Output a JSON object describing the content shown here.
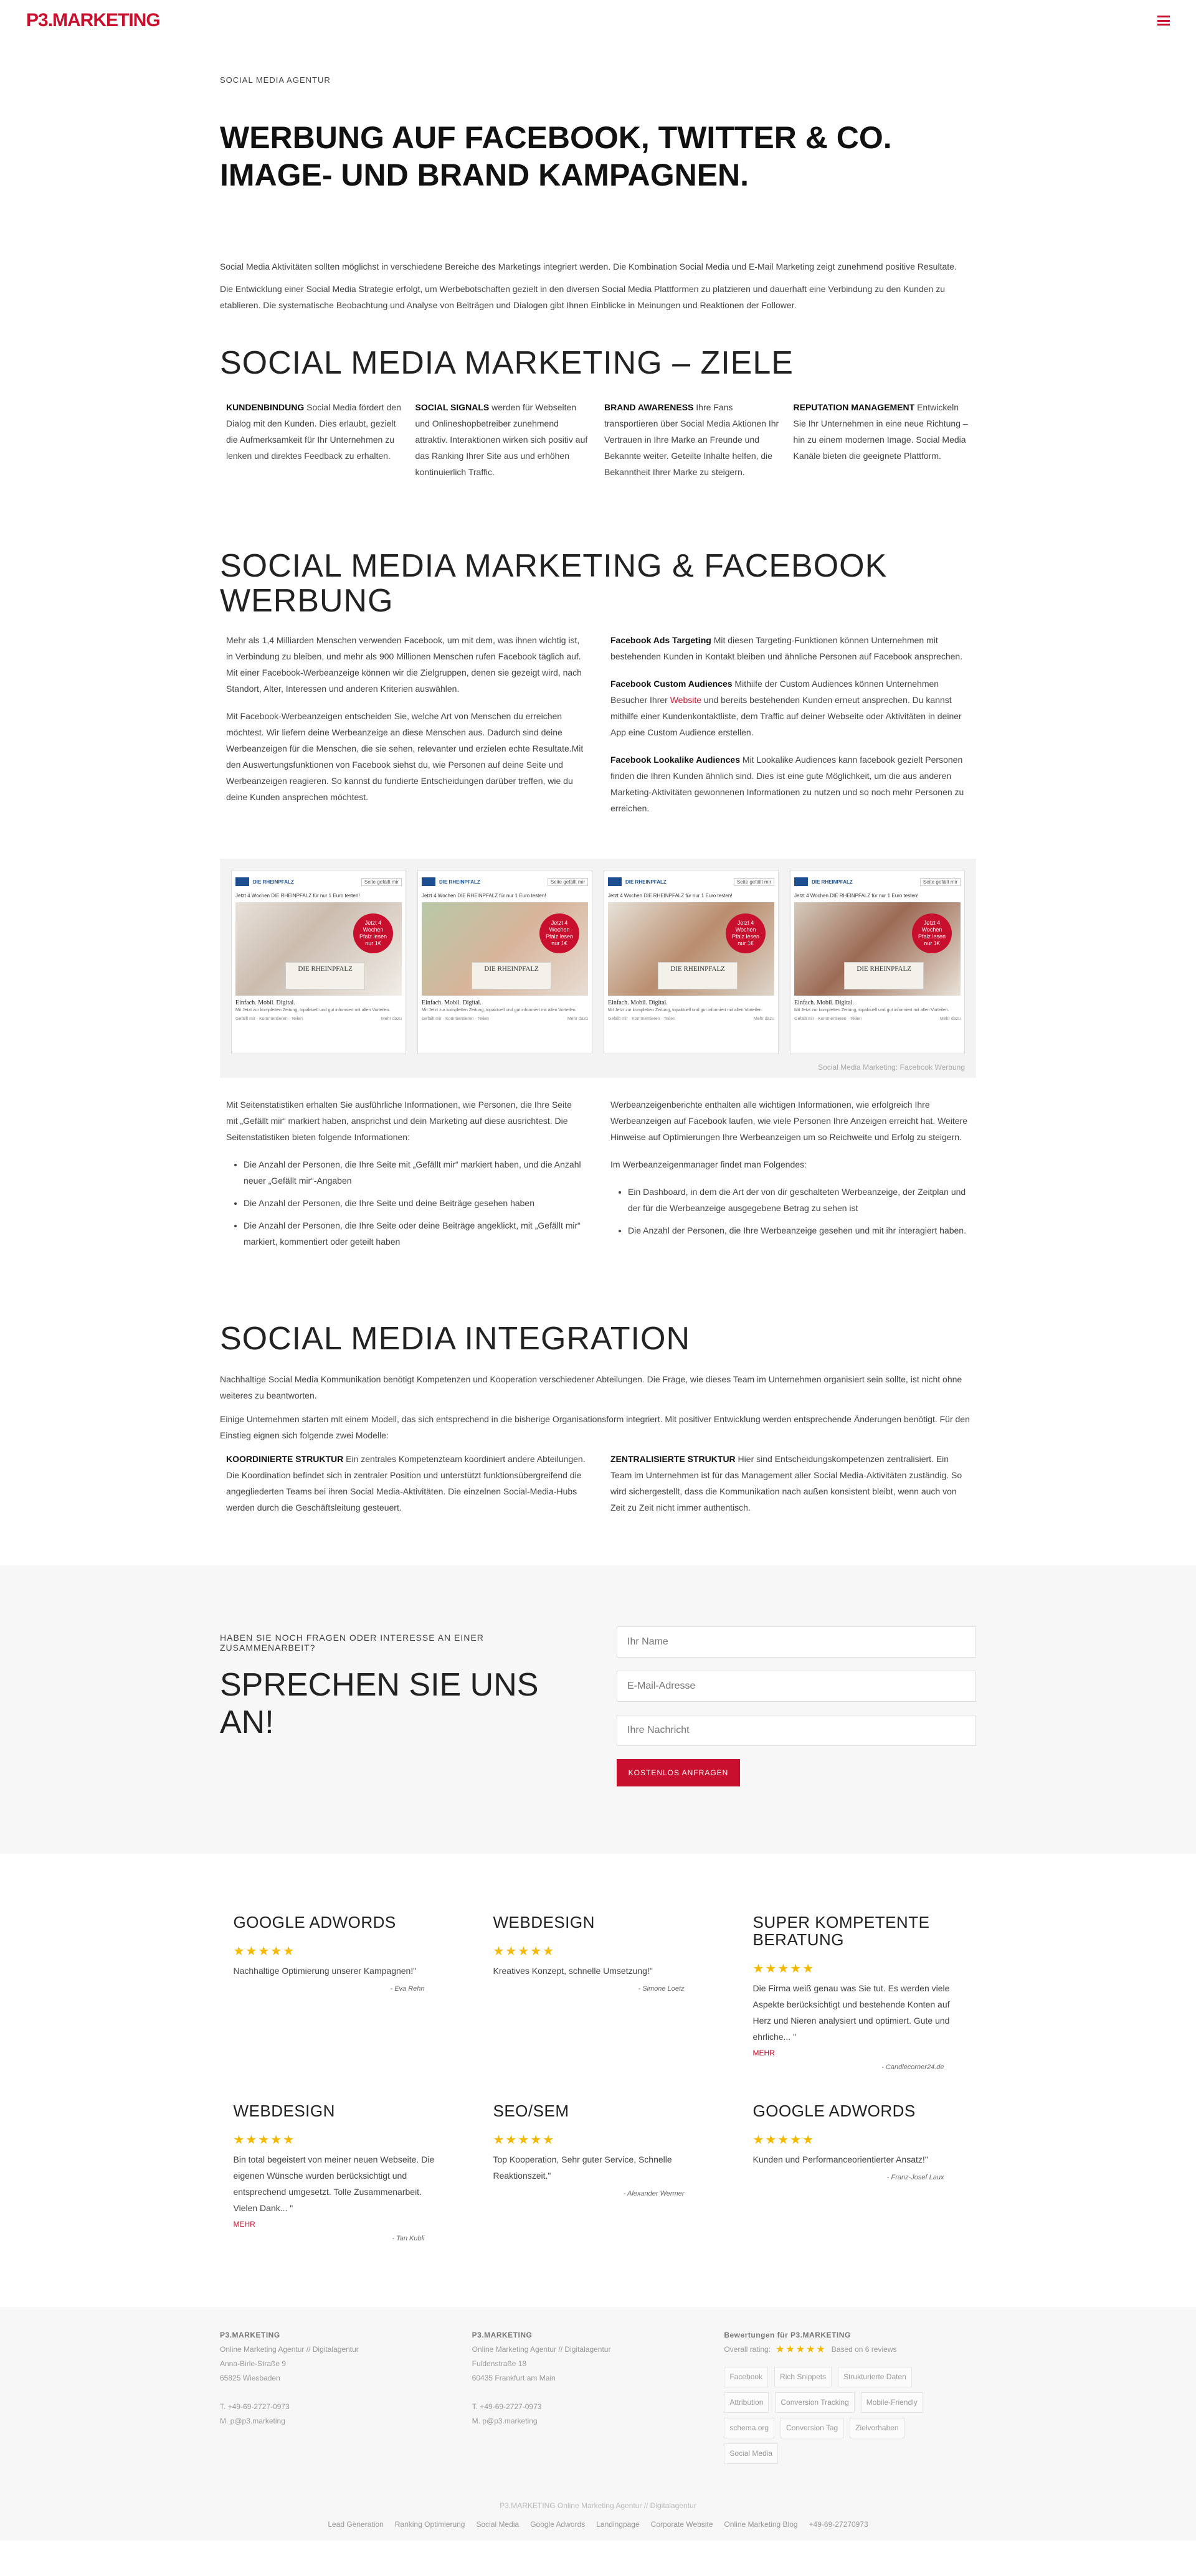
{
  "header": {
    "logo": "P3.MARKETING"
  },
  "hero": {
    "eyebrow": "SOCIAL MEDIA AGENTUR",
    "title_line1": "WERBUNG AUF FACEBOOK, TWITTER & CO.",
    "title_line2": "IMAGE- UND BRAND KAMPAGNEN.",
    "p1": "Social Media Aktivitäten sollten möglichst in verschiedene Bereiche des Marketings integriert werden. Die Kombination Social Media und E-Mail Marketing zeigt zunehmend positive Resultate.",
    "p2": "Die Entwicklung einer Social Media Strategie erfolgt, um Werbebotschaften gezielt in den diversen Social Media Plattformen zu platzieren und dauerhaft eine Verbindung zu den Kunden zu etablieren. Die systematische Beobachtung und Analyse von Beiträgen und Dialogen gibt Ihnen Einblicke in Meinungen und Reaktionen der Follower."
  },
  "ziele": {
    "title": "SOCIAL MEDIA MARKETING – ZIELE",
    "cols": [
      {
        "bold": "KUNDENBINDUNG",
        "text": " Social Media fördert den Dialog mit den Kunden. Dies erlaubt, gezielt die Aufmerksamkeit für Ihr Unternehmen zu lenken und direktes Feedback zu erhalten."
      },
      {
        "bold": "SOCIAL SIGNALS",
        "text": " werden für Webseiten und Onlineshopbetreiber zunehmend attraktiv. Interaktionen wirken sich positiv auf das Ranking Ihrer Site aus und erhöhen kontinuierlich Traffic."
      },
      {
        "bold": "BRAND AWARENESS",
        "text": " Ihre Fans transportieren über Social Media Aktionen Ihr Vertrauen in Ihre Marke an Freunde und Bekannte weiter. Geteilte Inhalte helfen, die Bekanntheit Ihrer Marke zu steigern."
      },
      {
        "bold": "REPUTATION MANAGEMENT",
        "text": " Entwickeln Sie Ihr Unternehmen in eine neue Richtung – hin zu einem modernen Image. Social Media Kanäle bieten die geeignete Plattform."
      }
    ]
  },
  "fb": {
    "title_line1": "SOCIAL MEDIA MARKETING & FACEBOOK",
    "title_line2": "WERBUNG",
    "left_p1": "Mehr als 1,4 Milliarden Menschen verwenden Facebook, um mit dem, was ihnen wichtig ist, in Verbindung zu bleiben, und mehr als 900 Millionen Menschen rufen Facebook täglich auf. Mit einer Facebook-Werbeanzeige können wir die Zielgruppen, denen sie gezeigt wird, nach Standort, Alter, Interessen und anderen Kriterien auswählen.",
    "left_p2": "Mit Facebook-Werbeanzeigen entscheiden Sie, welche Art von Menschen du erreichen möchtest. Wir liefern deine Werbeanzeige an diese Menschen aus. Dadurch sind deine Werbeanzeigen für die Menschen, die sie sehen, relevanter und erzielen echte Resultate.Mit den Auswertungsfunktionen von Facebook siehst du, wie Personen auf deine Seite und Werbeanzeigen reagieren. So kannst du fundierte Entscheidungen darüber treffen, wie du deine Kunden ansprechen möchtest.",
    "right_p1_bold": "Facebook Ads Targeting",
    "right_p1": " Mit diesen Targeting-Funktionen können Unternehmen mit bestehenden Kunden in Kontakt bleiben und ähnliche Personen auf Facebook ansprechen.",
    "right_p2_bold": "Facebook Custom Audiences",
    "right_p2a": " Mithilfe der Custom Audiences können Unternehmen Besucher Ihrer ",
    "right_p2_link": "Website",
    "right_p2b": " und bereits bestehenden Kunden erneut ansprechen. Du kannst mithilfe einer Kundenkontaktliste, dem Traffic auf deiner Webseite oder Aktivitäten in deiner App eine Custom Audience erstellen.",
    "right_p3_bold": "Facebook Lookalike Audiences",
    "right_p3": " Mit Lookalike Audiences kann facebook gezielt Personen finden die Ihren Kunden ähnlich sind. Dies ist eine gute Möglichkeit, um die aus anderen Marketing-Aktivitäten gewonnenen Informationen zu nutzen und so noch mehr Personen zu erreichen."
  },
  "gallery": {
    "page_name": "DIE RHEINPFALZ",
    "sponsored": "Gesponsert",
    "like": "Seite gefällt mir",
    "ad_text": "Jetzt 4 Wochen DIE RHEINPFALZ für nur 1 Euro testen!",
    "badge": "Jetzt 4 Wochen Pfalz lesen nur 1€",
    "paper": "DIE RHEINPFALZ",
    "sub": "Einfach. Mobil. Digital.",
    "desc": "Mit Jetzt zur kompletten Zeitung, topaktuell und gut informiert mit allen Vorteilen.",
    "more": "Mehr dazu",
    "foot": "Gefällt mir · Kommentieren · Teilen",
    "caption": "Social Media Marketing: Facebook Werbung"
  },
  "stats": {
    "left_intro": "Mit Seitenstatistiken erhalten Sie ausführliche Informationen, wie Personen, die Ihre Seite mit „Gefällt mir“ markiert haben, ansprichst und dein Marketing auf diese ausrichtest. Die Seitenstatistiken bieten folgende Informationen:",
    "left_items": [
      "Die Anzahl der Personen, die Ihre Seite mit „Gefällt mir“ markiert haben, und die Anzahl neuer „Gefällt mir“-Angaben",
      "Die Anzahl der Personen, die Ihre Seite und deine Beiträge gesehen haben",
      "Die Anzahl der Personen, die Ihre Seite oder deine Beiträge angeklickt, mit „Gefällt mir“ markiert, kommentiert oder geteilt haben"
    ],
    "right_intro": "Werbeanzeigenberichte enthalten alle wichtigen Informationen, wie erfolgreich Ihre Werbeanzeigen auf Facebook laufen, wie viele Personen Ihre Anzeigen erreicht hat. Weitere Hinweise auf Optimierungen Ihre Werbeanzeigen um so Reichweite und Erfolg zu steigern.",
    "right_intro2": "Im Werbeanzeigenmanager findet man Folgendes:",
    "right_items": [
      "Ein Dashboard, in dem die Art der von dir geschalteten Werbeanzeige, der Zeitplan und der für die Werbeanzeige ausgegebene Betrag zu sehen ist",
      "Die Anzahl der Personen, die Ihre Werbeanzeige gesehen und mit ihr interagiert haben."
    ]
  },
  "integration": {
    "title": "SOCIAL MEDIA INTEGRATION",
    "p1": "Nachhaltige Social Media Kommunikation benötigt Kompetenzen und Kooperation verschiedener Abteilungen. Die Frage, wie dieses Team im Unternehmen organisiert sein sollte, ist nicht ohne weiteres zu beantworten.",
    "p2": "Einige Unternehmen starten mit einem Modell, das sich entsprechend in die bisherige Organisationsform integriert. Mit positiver Entwicklung werden entsprechende Änderungen benötigt. Für den Einstieg eignen sich folgende zwei Modelle:",
    "left_bold": "KOORDINIERTE STRUKTUR",
    "left": " Ein zentrales Kompetenzteam koordiniert andere Abteilungen. Die Koordination befindet sich in zentraler Position und unterstützt funktionsübergreifend die angegliederten Teams bei ihren Social Media-Aktivitäten. Die einzelnen Social-Media-Hubs werden durch die Geschäftsleitung gesteuert.",
    "right_bold": "ZENTRALISIERTE STRUKTUR",
    "right": " Hier sind Entscheidungskompetenzen zentralisiert. Ein Team im Unternehmen ist für das Management aller Social Media-Aktivitäten zuständig. So wird sichergestellt, dass die Kommunikation nach außen konsistent bleibt, wenn auch von Zeit zu Zeit nicht immer authentisch."
  },
  "contact": {
    "small": "HABEN SIE NOCH FRAGEN ODER INTERESSE AN EINER ZUSAMMENARBEIT?",
    "big": "SPRECHEN SIE UNS AN!",
    "name_placeholder": "Ihr Name",
    "email_placeholder": "E-Mail-Adresse",
    "msg_placeholder": "Ihre Nachricht",
    "submit": "KOSTENLOS ANFRAGEN"
  },
  "reviews": [
    {
      "title": "GOOGLE ADWORDS",
      "stars": "★★★★★",
      "quote": "Nachhaltige Optimierung unserer Kampagnen!\"",
      "more": "",
      "author": "- Eva Rehn"
    },
    {
      "title": "WEBDESIGN",
      "stars": "★★★★★",
      "quote": "Kreatives Konzept, schnelle Umsetzung!\"",
      "more": "",
      "author": "- Simone Loetz"
    },
    {
      "title": "SUPER KOMPETENTE BERATUNG",
      "stars": "★★★★★",
      "quote": "Die Firma weiß genau was Sie tut. Es werden viele Aspekte berücksichtigt und bestehende Konten auf Herz und Nieren analysiert und optimiert. Gute und ehrliche... \"",
      "more": "MEHR",
      "author": "- Candlecorner24.de"
    },
    {
      "title": "WEBDESIGN",
      "stars": "★★★★★",
      "quote": "Bin total begeistert von meiner neuen Webseite. Die eigenen Wünsche wurden berücksichtigt und entsprechend umgesetzt. Tolle Zusammenarbeit. Vielen Dank... \"",
      "more": "MEHR",
      "author": "- Tan Kubli"
    },
    {
      "title": "SEO/SEM",
      "stars": "★★★★★",
      "quote": "Top Kooperation, Sehr guter Service, Schnelle Reaktionszeit.\"",
      "more": "",
      "author": "- Alexander Wermer"
    },
    {
      "title": "GOOGLE ADWORDS",
      "stars": "★★★★★",
      "quote": "Kunden und Performanceorientierter Ansatz!\"",
      "more": "",
      "author": "- Franz-Josef Laux"
    }
  ],
  "footer": {
    "col1": {
      "head": "P3.MARKETING",
      "l1": "Online Marketing Agentur // Digitalagentur",
      "l2": "Anna-Birle-Straße 9",
      "l3": "65825 Wiesbaden",
      "t": "T. +49-69-2727-0973",
      "m": "M. p@p3.marketing"
    },
    "col2": {
      "head": "P3.MARKETING",
      "l1": "Online Marketing Agentur // Digitalagentur",
      "l2": "Fuldenstraße 18",
      "l3": "60435 Frankfurt am Main",
      "t": "T. +49-69-2727-0973",
      "m": "M. p@p3.marketing"
    },
    "col3": {
      "head": "Bewertungen für P3.MARKETING",
      "overall": "Overall rating:",
      "stars": "★★★★★",
      "based": "Based on 6 reviews",
      "tags": [
        "Facebook",
        "Rich Snippets",
        "Strukturierte Daten",
        "Attribution",
        "Conversion Tracking",
        "Mobile-Friendly",
        "schema.org",
        "Conversion Tag",
        "Zielvorhaben",
        "Social Media"
      ]
    },
    "bottom": "P3.MARKETING Online Marketing Agentur // Digitalagentur",
    "links": [
      "Lead Generation",
      "Ranking Optimierung",
      "Social Media",
      "Google Adwords",
      "Landingpage",
      "Corporate Website",
      "Online Marketing Blog",
      "+49-69-27270973"
    ]
  },
  "colors": {
    "accent": "#c8102e",
    "stars": "#f5b800"
  }
}
